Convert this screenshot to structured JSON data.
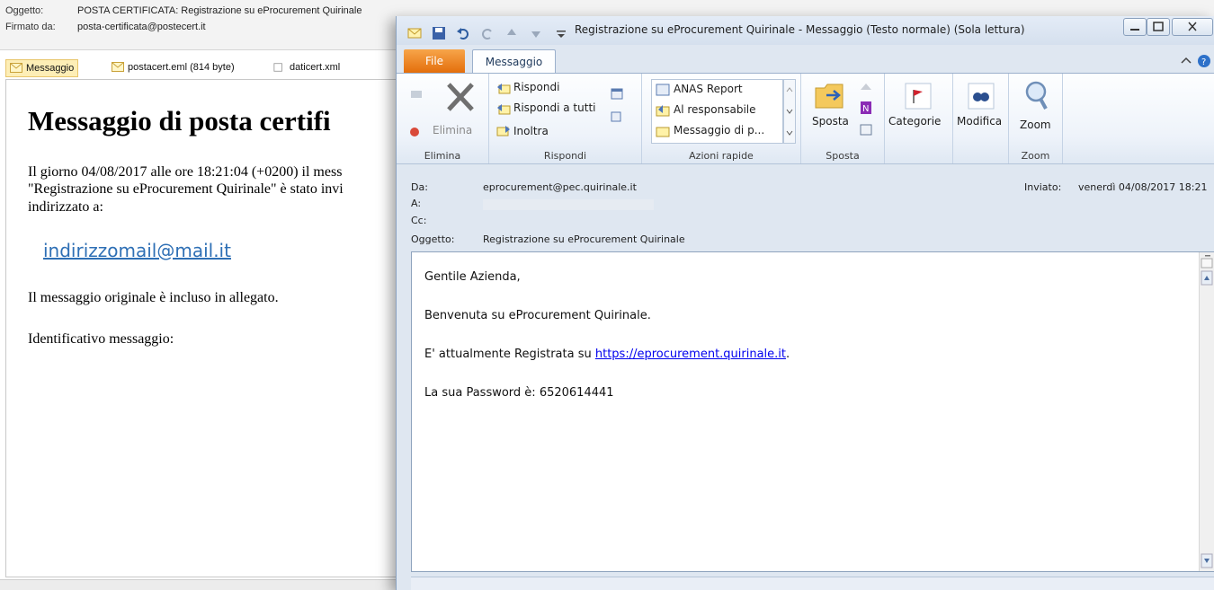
{
  "background_window": {
    "subject_label": "Oggetto:",
    "subject_value": "POSTA CERTIFICATA: Registrazione su eProcurement Quirinale",
    "signed_label": "Firmato da:",
    "signed_value": "posta-certificata@postecert.it",
    "tabs": [
      {
        "label": "Messaggio"
      },
      {
        "label": "postacert.eml (814 byte)"
      },
      {
        "label": "daticert.xml"
      }
    ],
    "body": {
      "title": "Messaggio di posta certifi",
      "line1": "Il giorno 04/08/2017 alle ore 18:21:04 (+0200) il mess",
      "line2": "\"Registrazione su eProcurement Quirinale\" è stato invi",
      "line3": "indirizzato a:",
      "address": "indirizzomail@mail.it",
      "original_note": "Il messaggio originale è incluso in allegato.",
      "id_label": "Identificativo messaggio:"
    }
  },
  "window": {
    "title": "Registrazione su eProcurement Quirinale  -  Messaggio (Testo normale) (Sola lettura)",
    "tabs": {
      "file": "File",
      "message": "Messaggio"
    }
  },
  "ribbon": {
    "elimina": {
      "button": "Elimina",
      "group": "Elimina"
    },
    "rispondi": {
      "reply": "Rispondi",
      "reply_all": "Rispondi a tutti",
      "forward": "Inoltra",
      "group": "Rispondi"
    },
    "azioni": {
      "items": [
        "ANAS Report",
        "Al responsabile",
        "Messaggio di p..."
      ],
      "group": "Azioni rapide"
    },
    "sposta": {
      "button": "Sposta",
      "group": "Sposta"
    },
    "categorie": {
      "button": "Categorie"
    },
    "modifica": {
      "button": "Modifica"
    },
    "zoom": {
      "button": "Zoom",
      "group": "Zoom"
    }
  },
  "headers": {
    "from_label": "Da:",
    "from_value": "eprocurement@pec.quirinale.it",
    "to_label": "A:",
    "cc_label": "Cc:",
    "subject_label": "Oggetto:",
    "subject_value": "Registrazione su eProcurement Quirinale",
    "sent_label": "Inviato:",
    "sent_value": "venerdì 04/08/2017 18:21"
  },
  "message_body": {
    "greeting": "Gentile Azienda,",
    "welcome": "Benvenuta su eProcurement Quirinale.",
    "registered_prefix": "E' attualmente Registrata su ",
    "registered_link": "https://eprocurement.quirinale.it",
    "registered_suffix": ".",
    "password_line": "La sua Password è: 6520614441"
  },
  "colors": {
    "file_tab": "#e36c09",
    "link": "#0000ee",
    "bg_link": "#2e6fb5",
    "ribbon_blue": "#dfe7f1"
  }
}
